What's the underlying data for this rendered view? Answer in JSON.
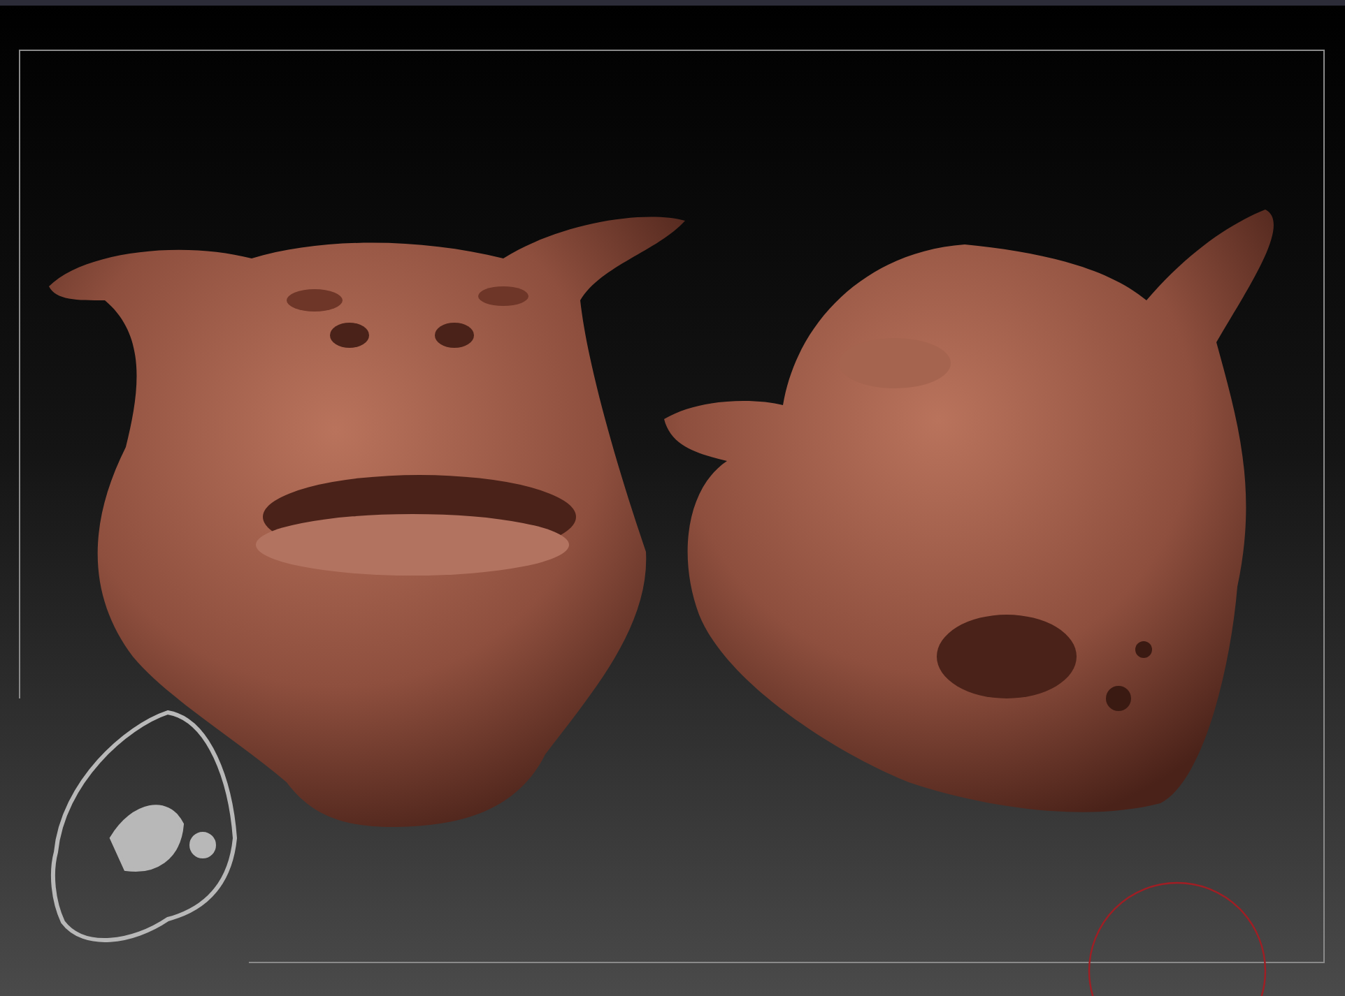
{
  "canvas": {
    "models": [
      {
        "kind": "head-front"
      },
      {
        "kind": "head-side"
      }
    ]
  }
}
